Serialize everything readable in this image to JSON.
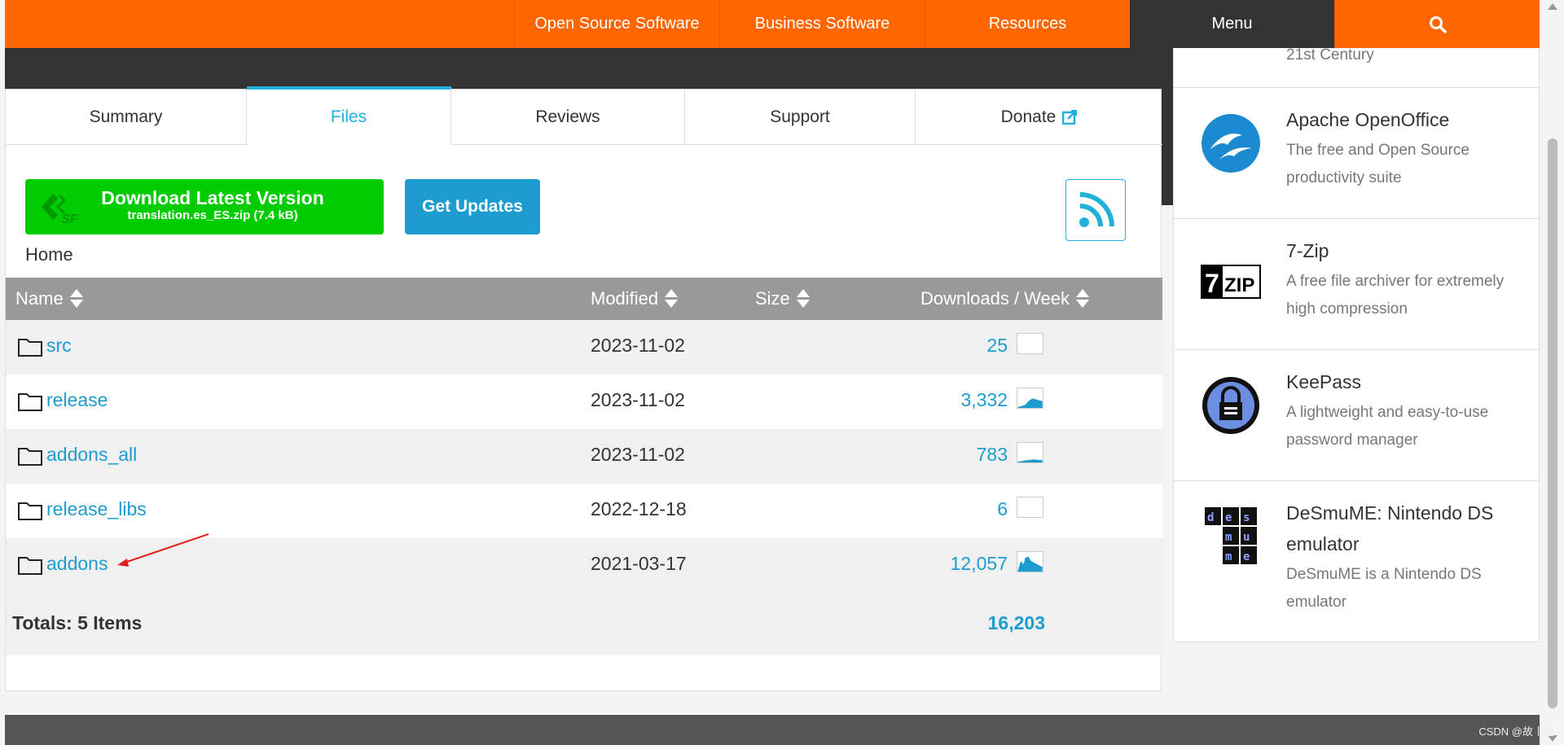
{
  "topnav": {
    "items": [
      "Open Source Software",
      "Business Software",
      "Resources",
      "Menu"
    ],
    "search_icon": "search-icon"
  },
  "tabs": [
    {
      "label": "Summary",
      "active": false
    },
    {
      "label": "Files",
      "active": true
    },
    {
      "label": "Reviews",
      "active": false
    },
    {
      "label": "Support",
      "active": false
    },
    {
      "label": "Donate",
      "active": false,
      "icon": "external-link-icon"
    }
  ],
  "download": {
    "title": "Download Latest Version",
    "file": "translation.es_ES.zip (7.4 kB)",
    "icon": "sf-logo-icon"
  },
  "get_updates": "Get Updates",
  "rss_icon": "rss-icon",
  "breadcrumb": "Home",
  "table": {
    "headers": [
      "Name",
      "Modified",
      "Size",
      "Downloads / Week"
    ],
    "rows": [
      {
        "name": "src",
        "modified": "2023-11-02",
        "size": "",
        "downloads": "25",
        "trend": "flat"
      },
      {
        "name": "release",
        "modified": "2023-11-02",
        "size": "",
        "downloads": "3,332",
        "trend": "up"
      },
      {
        "name": "addons_all",
        "modified": "2023-11-02",
        "size": "",
        "downloads": "783",
        "trend": "low"
      },
      {
        "name": "release_libs",
        "modified": "2022-12-18",
        "size": "",
        "downloads": "6",
        "trend": "flat"
      },
      {
        "name": "addons",
        "modified": "2021-03-17",
        "size": "",
        "downloads": "12,057",
        "trend": "spike"
      }
    ],
    "totals_label": "Totals: 5 Items",
    "totals_downloads": "16,203"
  },
  "sidebar": {
    "partial_text": "21st Century",
    "items": [
      {
        "name": "Apache OpenOffice",
        "desc": "The free and Open Source productivity suite",
        "icon": "openoffice-icon"
      },
      {
        "name": "7-Zip",
        "desc": "A free file archiver for extremely high compression",
        "icon": "7zip-icon"
      },
      {
        "name": "KeePass",
        "desc": "A lightweight and easy-to-use password manager",
        "icon": "keepass-lock-icon"
      },
      {
        "name": "DeSmuME: Nintendo DS emulator",
        "desc": "DeSmuME is a Nintendo DS emulator",
        "icon": "desmume-icon"
      }
    ]
  },
  "watermark": "CSDN @故丨是",
  "colors": {
    "brand": "#ff6600",
    "accent": "#1c9ccf",
    "download": "#00cc00"
  }
}
